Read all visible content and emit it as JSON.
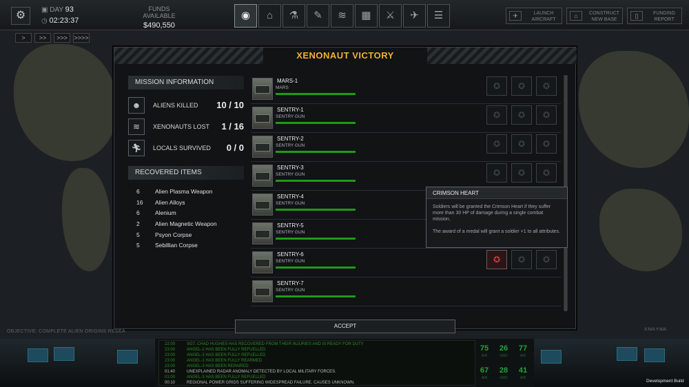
{
  "topbar": {
    "day_label": "DAY",
    "day_value": "93",
    "time": "02:23:37",
    "funds_label": "FUNDS AVAILABLE",
    "funds_value": "$490,550",
    "nav_icons": [
      "globe-icon",
      "hangar-icon",
      "research-icon",
      "engineering-icon",
      "soldiers-icon",
      "base-icon",
      "weapons-icon",
      "aircraft-icon",
      "storage-icon"
    ],
    "launch_aircraft": "LAUNCH AIRCRAFT",
    "construct_new_base": "CONSTRUCT NEW BASE",
    "funding_report": "FUNDING REPORT"
  },
  "speed_controls": [
    ">",
    ">>",
    ">>>",
    ">>>>"
  ],
  "dialog": {
    "title": "XENONAUT VICTORY",
    "mission_information": "MISSION INFORMATION",
    "stats": [
      {
        "label": "ALIENS KILLED",
        "value": "10 / 10"
      },
      {
        "label": "XENONAUTS LOST",
        "value": "1 / 16"
      },
      {
        "label": "LOCALS SURVIVED",
        "value": "0 / 0"
      }
    ],
    "recovered_items_label": "RECOVERED ITEMS",
    "recovered_items": [
      {
        "qty": "6",
        "name": "Alien Plasma Weapon"
      },
      {
        "qty": "16",
        "name": "Alien Alloys"
      },
      {
        "qty": "6",
        "name": "Alenium"
      },
      {
        "qty": "2",
        "name": "Alien Magnetic Weapon"
      },
      {
        "qty": "5",
        "name": "Psyon Corpse"
      },
      {
        "qty": "5",
        "name": "Sebillian Corpse"
      }
    ],
    "roster": [
      {
        "name": "MARS-1",
        "type": "MARS",
        "medal_awarded": false
      },
      {
        "name": "SENTRY-1",
        "type": "SENTRY GUN",
        "medal_awarded": false
      },
      {
        "name": "SENTRY-2",
        "type": "SENTRY GUN",
        "medal_awarded": false
      },
      {
        "name": "SENTRY-3",
        "type": "SENTRY GUN",
        "medal_awarded": false
      },
      {
        "name": "SENTRY-4",
        "type": "SENTRY GUN",
        "medal_awarded": false
      },
      {
        "name": "SENTRY-5",
        "type": "SENTRY GUN",
        "medal_awarded": false
      },
      {
        "name": "SENTRY-6",
        "type": "SENTRY GUN",
        "medal_awarded": true
      },
      {
        "name": "SENTRY-7",
        "type": "SENTRY GUN",
        "medal_awarded": false
      }
    ],
    "accept_label": "ACCEPT"
  },
  "tooltip": {
    "title": "CRIMSON HEART",
    "text1": "Soldiers will be granted the Crimson Heart if they suffer more than 30 HP of damage during a single combat mission.",
    "text2": "The award of a medal will grant a soldier +1 to all attributes."
  },
  "objective": "OBJECTIVE: COMPLETE ALIEN ORIGINS RESEA",
  "xna": "X:N/A   Y:N/A",
  "log": [
    {
      "time": "22:00",
      "msg": "SGT. CHAD HUGHES HAS RECOVERED FROM THEIR INJURIES AND IS READY FOR DUTY",
      "color": "#2c8a2c"
    },
    {
      "time": "23:00",
      "msg": "ANGEL-1 HAS BEEN FULLY REFUELLED",
      "color": "#2c8a2c"
    },
    {
      "time": "23:00",
      "msg": "ANGEL-3 HAS BEEN FULLY REFUELLED",
      "color": "#2c8a2c"
    },
    {
      "time": "23:00",
      "msg": "ANGEL-1 HAS BEEN FULLY REARMED",
      "color": "#2c8a2c"
    },
    {
      "time": "23:00",
      "msg": "ANGEL-3 HAS BEEN REPAIRED",
      "color": "#2c8a2c"
    },
    {
      "time": "01:40",
      "msg": "UNEXPLAINED RADAR ANOMALY DETECTED BY LOCAL MILITARY FORCES.",
      "color": "#b9bdbf"
    },
    {
      "time": "01:00",
      "msg": "ANGEL-3 HAS BEEN FULLY REFUELLED",
      "color": "#2c8a2c"
    },
    {
      "time": "00:10",
      "msg": "REGIONAL POWER GRIDS SUFFERING WIDESPREAD FAILURE. CAUSES UNKNOWN.",
      "color": "#b9bdbf"
    }
  ],
  "gauges": [
    {
      "value": "75",
      "label": "AIR"
    },
    {
      "value": "26",
      "label": "GRD"
    },
    {
      "value": "77",
      "label": "AIR"
    },
    {
      "value": "67",
      "label": "AIR"
    },
    {
      "value": "28",
      "label": "GRD"
    },
    {
      "value": "41",
      "label": "AIR"
    }
  ],
  "dev_build": "Development Build"
}
